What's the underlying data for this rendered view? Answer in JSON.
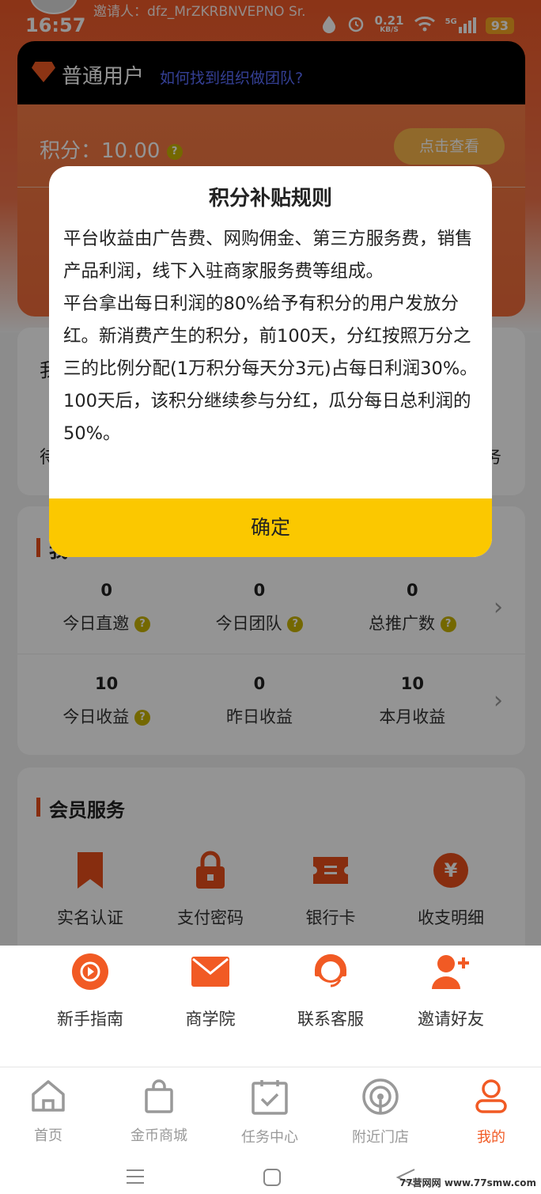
{
  "status_bar": {
    "time": "16:57",
    "speed": "0.21",
    "speed_unit": "KB/S",
    "network": "5G",
    "battery": "93"
  },
  "header": {
    "inviter": "邀请人：dfz_MrZKRBNVEPNO Sr.",
    "member_level": "普通用户",
    "team_link": "如何找到组织做团队?"
  },
  "points_card": {
    "points_label": "积分：10.00",
    "view_button": "点击查看"
  },
  "card1": {
    "title_char": "我",
    "bottom_left_char": "待",
    "bottom_right_char": "务"
  },
  "stats": {
    "section_char": "我",
    "row1": [
      {
        "value": "0",
        "label": "今日直邀",
        "help": true
      },
      {
        "value": "0",
        "label": "今日团队",
        "help": true
      },
      {
        "value": "0",
        "label": "总推广数",
        "help": true
      }
    ],
    "row2": [
      {
        "value": "10",
        "label": "今日收益",
        "help": true
      },
      {
        "value": "0",
        "label": "昨日收益",
        "help": false
      },
      {
        "value": "10",
        "label": "本月收益",
        "help": false
      }
    ]
  },
  "member_service": {
    "title": "会员服务",
    "row1": [
      {
        "label": "实名认证",
        "icon": "bookmark-icon"
      },
      {
        "label": "支付密码",
        "icon": "lock-icon"
      },
      {
        "label": "银行卡",
        "icon": "bank-card-icon"
      },
      {
        "label": "收支明细",
        "icon": "yen-icon"
      }
    ],
    "row2": [
      {
        "label": "新手指南",
        "icon": "play-icon"
      },
      {
        "label": "商学院",
        "icon": "mail-icon"
      },
      {
        "label": "联系客服",
        "icon": "support-agent-icon"
      },
      {
        "label": "邀请好友",
        "icon": "add-user-icon"
      }
    ]
  },
  "modal": {
    "title": "积分补贴规则",
    "paragraph1": "平台收益由广告费、网购佣金、第三方服务费，销售产品利润，线下入驻商家服务费等组成。",
    "paragraph2": "平台拿出每日利润的80%给予有积分的用户发放分红。新消费产生的积分，前100天，分红按照万分之三的比例分配(1万积分每天分3元)占每日利润30%。100天后，该积分继续参与分红，瓜分每日总利润的50%。",
    "confirm": "确定"
  },
  "tabbar": [
    {
      "label": "首页",
      "icon": "home-icon",
      "active": false
    },
    {
      "label": "金币商城",
      "icon": "shopping-bag-icon",
      "active": false
    },
    {
      "label": "任务中心",
      "icon": "task-icon",
      "active": false
    },
    {
      "label": "附近门店",
      "icon": "location-icon",
      "active": false
    },
    {
      "label": "我的",
      "icon": "user-icon",
      "active": true
    }
  ],
  "watermark": "77营网网 www.77smw.com",
  "colors": {
    "accent": "#f15a24",
    "confirm_bg": "#fbc800",
    "link": "#5a6dff"
  }
}
